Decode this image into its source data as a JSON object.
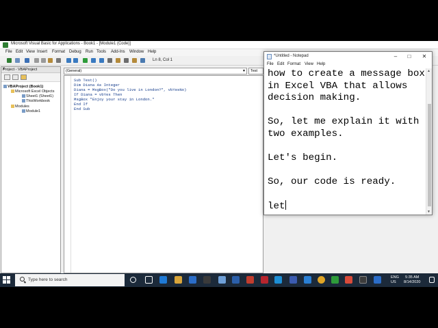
{
  "vba": {
    "title": "Microsoft Visual Basic for Applications - Book1 - [Module1 (Code)]",
    "menu": [
      "File",
      "Edit",
      "View",
      "Insert",
      "Format",
      "Debug",
      "Run",
      "Tools",
      "Add-Ins",
      "Window",
      "Help"
    ],
    "cursor_position": "Ln 8, Col 1",
    "project_panel_title": "Project - VBAProject",
    "project_close": "x",
    "tree": [
      "VBAProject (Book1)",
      "Microsoft Excel Objects",
      "Sheet1 (Sheet1)",
      "ThisWorkbook",
      "Modules",
      "Module1"
    ],
    "object_combo": "(General)",
    "procedure_combo": "Test",
    "code_lines": [
      "Sub Test()",
      "Dim Diana As Integer",
      "Diana = MsgBox(\"Do you live in London?\", vbYesNo)",
      "If Diana = vbYes Then",
      "MsgBox \"Enjoy your stay in London.\"",
      "End If",
      "End Sub"
    ]
  },
  "notepad": {
    "title": "*Untitled - Notepad",
    "menu": [
      "File",
      "Edit",
      "Format",
      "View",
      "Help"
    ],
    "lines": [
      "how to create a message box",
      "in Excel VBA that allows",
      "decision making.",
      "",
      "So, let me explain it with",
      "two examples.",
      "",
      "Let's begin.",
      "",
      "So, our code is ready.",
      "",
      "let"
    ],
    "minimize": "–",
    "maximize": "□",
    "close": "✕"
  },
  "taskbar": {
    "search_placeholder": "Type here to search",
    "language_top": "ENG",
    "language_bottom": "US",
    "time": "5:35 AM",
    "date": "8/14/2020"
  }
}
